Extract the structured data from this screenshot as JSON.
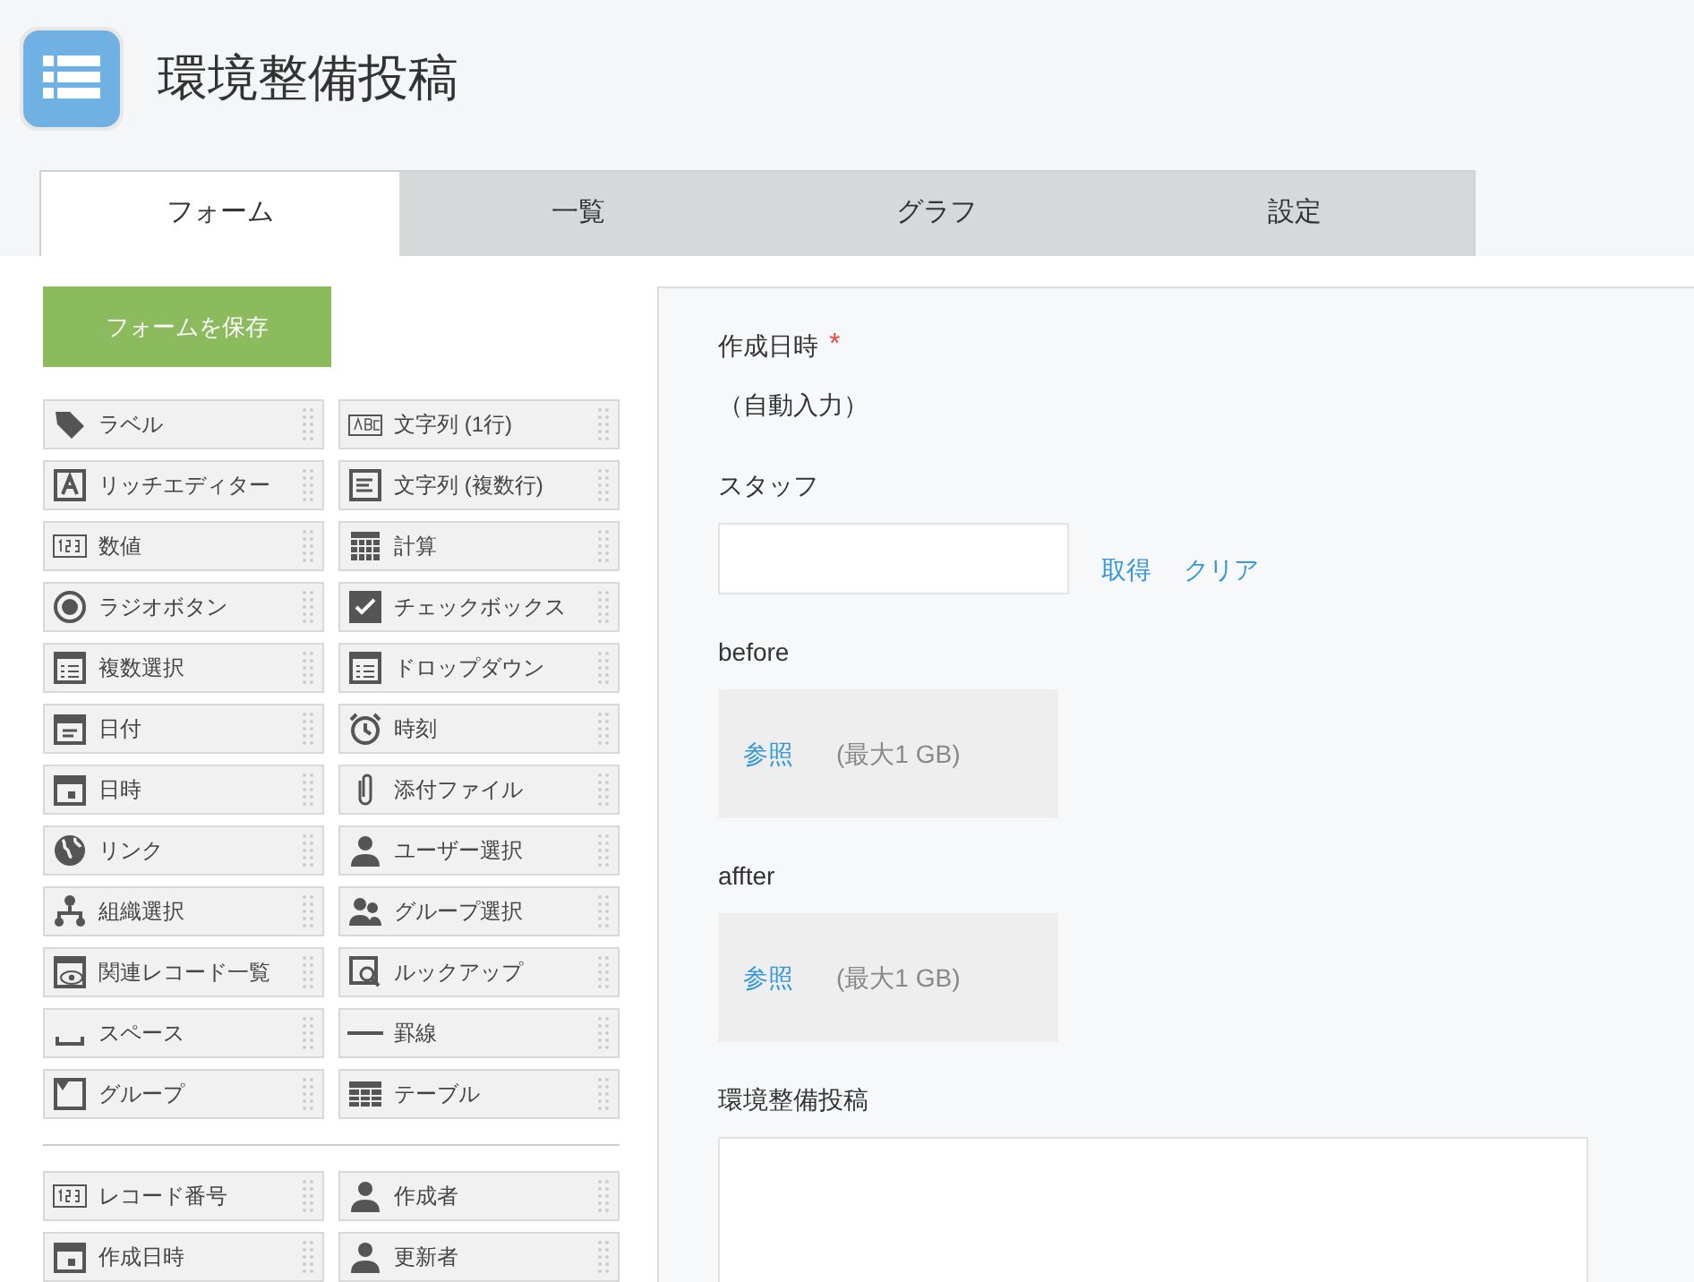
{
  "app": {
    "title": "環境整備投稿"
  },
  "tabs": [
    {
      "label": "フォーム",
      "selected": true
    },
    {
      "label": "一覧",
      "selected": false
    },
    {
      "label": "グラフ",
      "selected": false
    },
    {
      "label": "設定",
      "selected": false
    }
  ],
  "save_button": "フォームを保存",
  "palette": [
    {
      "label": "ラベル",
      "kind": "tag"
    },
    {
      "label": "文字列 (1行)",
      "kind": "abc"
    },
    {
      "label": "リッチエディター",
      "kind": "rich"
    },
    {
      "label": "文字列 (複数行)",
      "kind": "multiline"
    },
    {
      "label": "数値",
      "kind": "number"
    },
    {
      "label": "計算",
      "kind": "calc"
    },
    {
      "label": "ラジオボタン",
      "kind": "radio"
    },
    {
      "label": "チェックボックス",
      "kind": "check"
    },
    {
      "label": "複数選択",
      "kind": "list"
    },
    {
      "label": "ドロップダウン",
      "kind": "list"
    },
    {
      "label": "日付",
      "kind": "date"
    },
    {
      "label": "時刻",
      "kind": "clock"
    },
    {
      "label": "日時",
      "kind": "datetime"
    },
    {
      "label": "添付ファイル",
      "kind": "clip"
    },
    {
      "label": "リンク",
      "kind": "globe"
    },
    {
      "label": "ユーザー選択",
      "kind": "user"
    },
    {
      "label": "組織選択",
      "kind": "org"
    },
    {
      "label": "グループ選択",
      "kind": "users"
    },
    {
      "label": "関連レコード一覧",
      "kind": "related"
    },
    {
      "label": "ルックアップ",
      "kind": "lookup"
    },
    {
      "label": "スペース",
      "kind": "space"
    },
    {
      "label": "罫線",
      "kind": "line"
    },
    {
      "label": "グループ",
      "kind": "group"
    },
    {
      "label": "テーブル",
      "kind": "table"
    }
  ],
  "system_fields": [
    {
      "label": "レコード番号",
      "kind": "number"
    },
    {
      "label": "作成者",
      "kind": "user"
    },
    {
      "label": "作成日時",
      "kind": "datetime"
    },
    {
      "label": "更新者",
      "kind": "user"
    }
  ],
  "form": [
    {
      "kind": "auto",
      "label": "作成日時",
      "required_mark": "*",
      "value": "（自動入力）"
    },
    {
      "kind": "user",
      "label": "スタッフ",
      "links": [
        "取得",
        "クリア"
      ]
    },
    {
      "kind": "file",
      "label": "before",
      "browse": "参照",
      "limit": "(最大1 GB)"
    },
    {
      "kind": "file",
      "label": "affter",
      "browse": "参照",
      "limit": "(最大1 GB)"
    },
    {
      "kind": "textarea",
      "label": "環境整備投稿"
    }
  ]
}
